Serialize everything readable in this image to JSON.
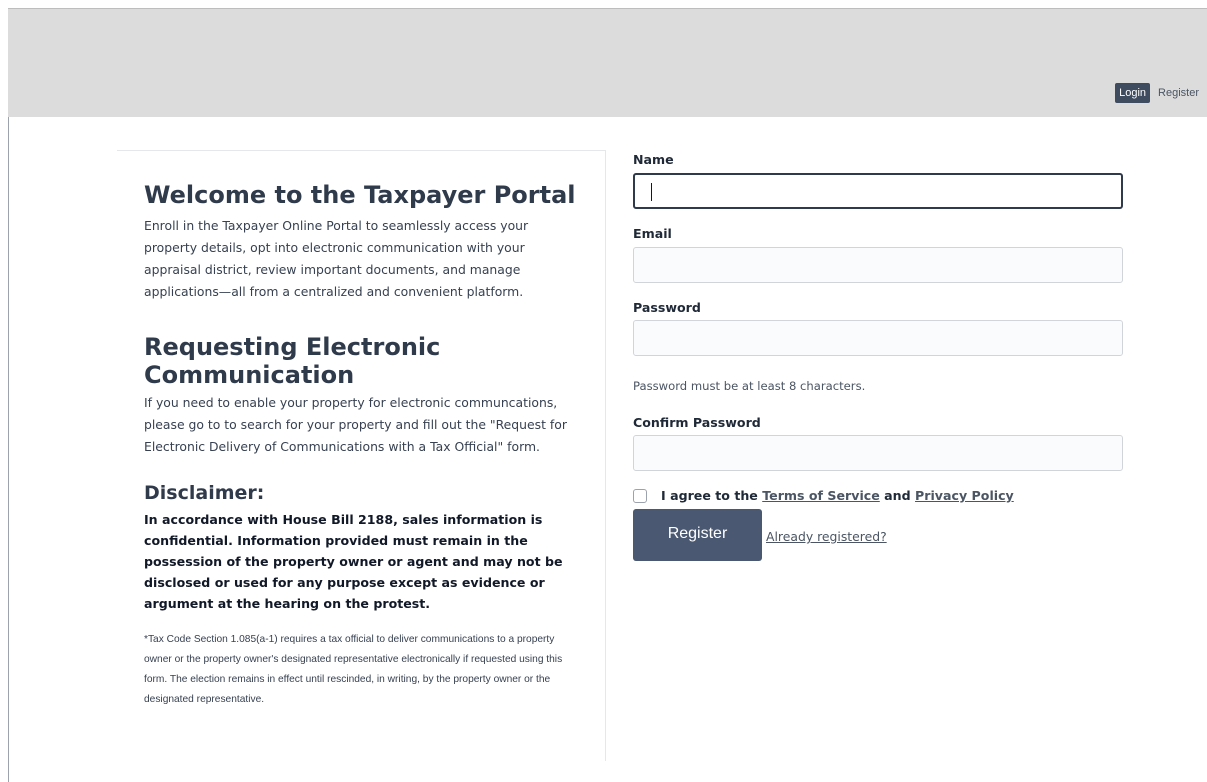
{
  "nav": {
    "login_label": "Login",
    "register_label": "Register"
  },
  "intro": {
    "title": "Welcome to the Taxpayer Portal",
    "body": "Enroll in the Taxpayer Online Portal to seamlessly access your property details, opt into electronic communication with your appraisal district, review important documents, and manage applications—all from a centralized and convenient platform."
  },
  "electronic": {
    "title": "Requesting Electronic Communication",
    "body": "If you need to enable your property for electronic communcations, please go to to search for your property and fill out the \"Request for Electronic Delivery of Communications with a Tax Official\" form."
  },
  "disclaimer": {
    "title": "Disclaimer:",
    "bold_text": "In accordance with House Bill 2188, sales information is confidential. Information provided must remain in the possession of the property owner or agent and may not be disclosed or used for any purpose except as evidence or argument at the hearing on the protest.",
    "footnote": "*Tax Code Section 1.085(a-1) requires a tax official to deliver communications to a property owner or the property owner's designated representative electronically if requested using this form. The election remains in effect until rescinded, in writing, by the property owner or the designated representative."
  },
  "form": {
    "name_label": "Name",
    "name_value": "",
    "email_label": "Email",
    "email_value": "",
    "password_label": "Password",
    "password_value": "",
    "password_hint": "Password must be at least 8 characters.",
    "confirm_label": "Confirm Password",
    "confirm_value": "",
    "agree_prefix": "I agree to the ",
    "terms_link": "Terms of Service",
    "agree_and": " and ",
    "privacy_link": "Privacy Policy",
    "register_button": "Register",
    "already_link": "Already registered?"
  },
  "colors": {
    "header_bg": "#dcdcdc",
    "button_bg": "#4a5872",
    "nav_login_bg": "#3f4b5e",
    "heading": "#2f3a4b"
  }
}
